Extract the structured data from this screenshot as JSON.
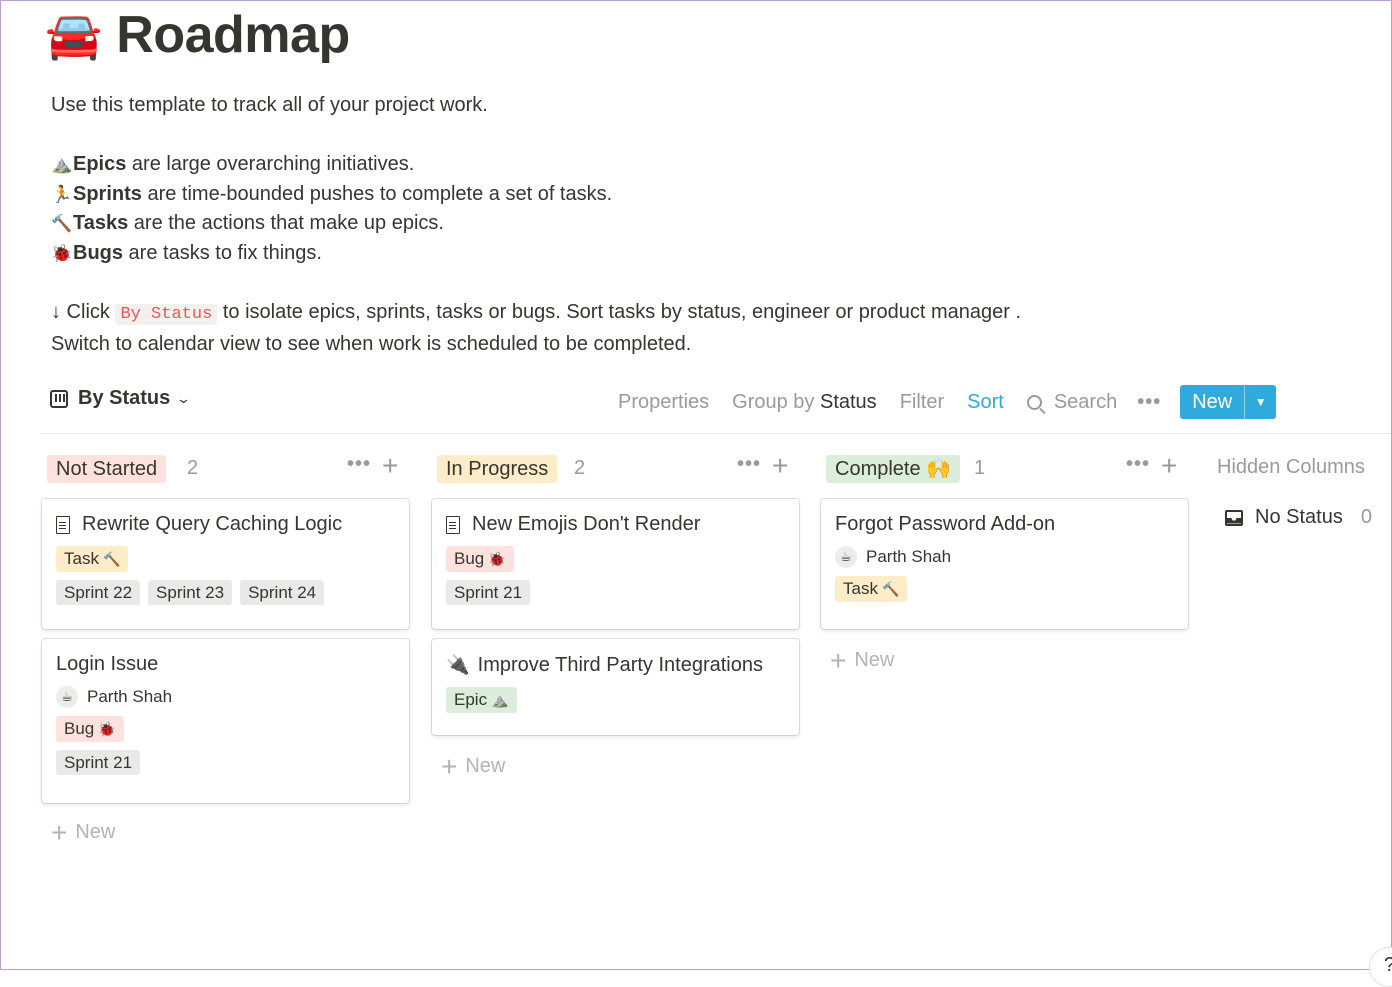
{
  "page": {
    "emoji": "🚘",
    "title": "Roadmap"
  },
  "description": {
    "intro": "Use this template to track all of your project work.",
    "lines": [
      {
        "emoji": "⛰️",
        "term": "Epics",
        "text": " are large overarching initiatives."
      },
      {
        "emoji": "🏃",
        "term": "Sprints",
        "text": " are time-bounded pushes to complete a set of tasks."
      },
      {
        "emoji": "🔨",
        "term": "Tasks",
        "text": " are the actions that make up epics."
      },
      {
        "emoji": "🐞",
        "term": "Bugs",
        "text": " are tasks to fix things."
      }
    ],
    "click_prefix": "↓ Click ",
    "click_code": "By Status",
    "click_suffix": " to isolate epics, sprints, tasks or bugs. Sort tasks by status, engineer or product manager .",
    "switch_line": "Switch to calendar view to see when work is scheduled to be completed."
  },
  "toolbar": {
    "view_label": "By Status",
    "properties": "Properties",
    "group_by_prefix": "Group by ",
    "group_by_value": "Status",
    "filter": "Filter",
    "sort": "Sort",
    "search": "Search",
    "more": "•••",
    "new_label": "New",
    "new_dropdown": "⌄"
  },
  "columns": [
    {
      "status": "Not Started",
      "count": "2",
      "color": "#ffe2dd",
      "cards": [
        {
          "title": "Rewrite Query Caching Logic",
          "icon": "document-icon",
          "tags_row1": [
            {
              "label": "Task",
              "emoji": "🔨",
              "kind": "task"
            }
          ],
          "tags_row2": [
            "Sprint 22",
            "Sprint 23",
            "Sprint 24"
          ]
        },
        {
          "title": "Login Issue",
          "person": "Parth Shah",
          "avatar": "☕",
          "tags_row1": [
            {
              "label": "Bug",
              "emoji": "🐞",
              "kind": "bug"
            }
          ],
          "tags_row2": [
            "Sprint 21"
          ]
        }
      ],
      "new_label": "New"
    },
    {
      "status": "In Progress",
      "count": "2",
      "color": "#fdecc8",
      "cards": [
        {
          "title": "New Emojis Don't Render",
          "icon": "document-icon",
          "tags_row1": [
            {
              "label": "Bug",
              "emoji": "🐞",
              "kind": "bug"
            }
          ],
          "tags_row2": [
            "Sprint 21"
          ]
        },
        {
          "title": "Improve Third Party Integrations",
          "emoji": "🔌",
          "tags_row1": [
            {
              "label": "Epic",
              "emoji": "⛰️",
              "kind": "epic"
            }
          ]
        }
      ],
      "new_label": "New"
    },
    {
      "status": "Complete",
      "status_emoji": "🙌",
      "count": "1",
      "color": "#dbeddb",
      "cards": [
        {
          "title": "Forgot Password Add-on",
          "person": "Parth Shah",
          "avatar": "☕",
          "tags_row1": [
            {
              "label": "Task",
              "emoji": "🔨",
              "kind": "task"
            }
          ]
        }
      ],
      "new_label": "New"
    }
  ],
  "hidden": {
    "title": "Hidden Columns",
    "no_status": "No Status",
    "no_status_count": "0"
  },
  "help": "?",
  "colors": {
    "accent": "#2eaadc",
    "text": "#37352f",
    "muted": "#9b9a97"
  }
}
